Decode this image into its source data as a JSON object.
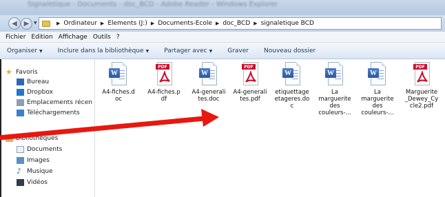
{
  "window": {
    "title_blurred": "Signaletique - Documents - doc_BCD - Adobe Reader - Windows Explorer"
  },
  "address": {
    "crumbs": [
      "Ordinateur",
      "Elements (J:)",
      "Documents-Ecole",
      "doc_BCD",
      "signaletique BCD"
    ]
  },
  "menu": [
    "Fichier",
    "Edition",
    "Affichage",
    "Outils",
    "?"
  ],
  "toolbar": [
    "Organiser",
    "Inclure dans la bibliothèque",
    "Partager avec",
    "Graver",
    "Nouveau dossier"
  ],
  "nav": {
    "favorites_header": "Favoris",
    "favorites": [
      "Bureau",
      "Dropbox",
      "Emplacements récen",
      "Téléchargements"
    ],
    "libraries_header": "Bibliothèques",
    "libraries": [
      "Documents",
      "Images",
      "Musique",
      "Vidéos"
    ]
  },
  "files": [
    {
      "name_lines": [
        "A4-fiches.d",
        "oc"
      ],
      "type": "word"
    },
    {
      "name_lines": [
        "A4-fiches.p",
        "df"
      ],
      "type": "pdf"
    },
    {
      "name_lines": [
        "A4-generali",
        "tes.doc"
      ],
      "type": "word"
    },
    {
      "name_lines": [
        "A4-generali",
        "tes.pdf"
      ],
      "type": "pdf"
    },
    {
      "name_lines": [
        "etiquettage",
        "etageres.do",
        "c"
      ],
      "type": "word"
    },
    {
      "name_lines": [
        "La",
        "marguerite",
        "des",
        "couleurs-..."
      ],
      "type": "word"
    },
    {
      "name_lines": [
        "La",
        "marguerite",
        "des",
        "couleurs-..."
      ],
      "type": "word"
    },
    {
      "name_lines": [
        "Marguerite",
        "_Dewey_Cy",
        "cle2.pdf"
      ],
      "type": "pdf"
    }
  ],
  "colors": {
    "arrow": "#e8170f",
    "pdf_red": "#c8102e",
    "word_blue": "#2a56a0"
  }
}
